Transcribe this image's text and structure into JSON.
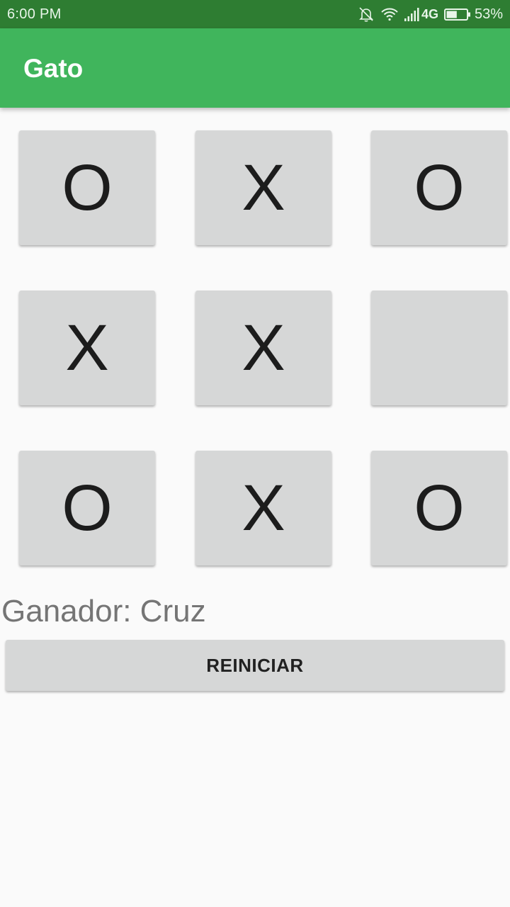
{
  "status_bar": {
    "time": "6:00 PM",
    "network": "4G",
    "battery": "53%",
    "battery_level": 0.53,
    "icons": [
      "bell-off-icon",
      "wifi-icon",
      "signal-icon",
      "battery-icon"
    ]
  },
  "app_bar": {
    "title": "Gato",
    "color": "#40b55c",
    "status_color": "#2e7d32"
  },
  "board": {
    "rows": [
      [
        "O",
        "X",
        "O"
      ],
      [
        "X",
        "X",
        ""
      ],
      [
        "O",
        "X",
        "O"
      ]
    ]
  },
  "result": {
    "text": "Ganador: Cruz"
  },
  "actions": {
    "reset_label": "REINICIAR"
  }
}
